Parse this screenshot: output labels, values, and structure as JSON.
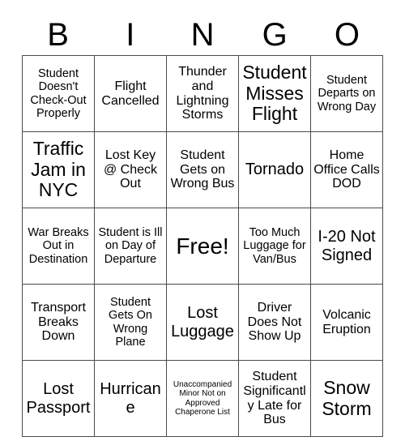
{
  "card": {
    "header_letters": [
      "B",
      "I",
      "N",
      "G",
      "O"
    ],
    "rows": [
      [
        {
          "text": "Student Doesn't Check-Out Properly",
          "size": "sm"
        },
        {
          "text": "Flight Cancelled",
          "size": "md"
        },
        {
          "text": "Thunder and Lightning Storms",
          "size": "md"
        },
        {
          "text": "Student Misses Flight",
          "size": "xl"
        },
        {
          "text": "Student Departs on Wrong Day",
          "size": "sm"
        }
      ],
      [
        {
          "text": "Traffic Jam in NYC",
          "size": "xl"
        },
        {
          "text": "Lost Key @ Check Out",
          "size": "md"
        },
        {
          "text": "Student Gets on Wrong Bus",
          "size": "md"
        },
        {
          "text": "Tornado",
          "size": "lg"
        },
        {
          "text": "Home Office Calls DOD",
          "size": "md"
        }
      ],
      [
        {
          "text": "War Breaks Out in Destination",
          "size": "sm"
        },
        {
          "text": "Student is Ill on Day of Departure",
          "size": "sm"
        },
        {
          "text": "Free!",
          "size": "free"
        },
        {
          "text": "Too Much Luggage for Van/Bus",
          "size": "sm"
        },
        {
          "text": "I-20 Not Signed",
          "size": "lg"
        }
      ],
      [
        {
          "text": "Transport Breaks Down",
          "size": "md"
        },
        {
          "text": "Student Gets On Wrong Plane",
          "size": "sm"
        },
        {
          "text": "Lost Luggage",
          "size": "lg"
        },
        {
          "text": "Driver Does Not Show Up",
          "size": "md"
        },
        {
          "text": "Volcanic Eruption",
          "size": "md"
        }
      ],
      [
        {
          "text": "Lost Passport",
          "size": "lg"
        },
        {
          "text": "Hurricane",
          "size": "lg"
        },
        {
          "text": "Unaccompanied Minor Not on Approved Chaperone List",
          "size": "xs"
        },
        {
          "text": "Student Significantly Late for Bus",
          "size": "md"
        },
        {
          "text": "Snow Storm",
          "size": "xl"
        }
      ]
    ]
  }
}
